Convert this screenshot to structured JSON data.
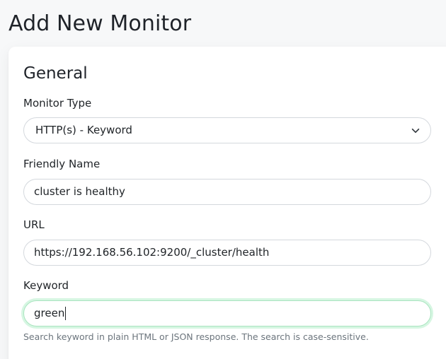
{
  "page": {
    "title": "Add New Monitor"
  },
  "general": {
    "section_title": "General",
    "monitor_type": {
      "label": "Monitor Type",
      "value": "HTTP(s) - Keyword"
    },
    "friendly_name": {
      "label": "Friendly Name",
      "value": "cluster is healthy"
    },
    "url": {
      "label": "URL",
      "value": "https://192.168.56.102:9200/_cluster/health"
    },
    "keyword": {
      "label": "Keyword",
      "value": "green",
      "help": "Search keyword in plain HTML or JSON response. The search is case-sensitive."
    }
  },
  "icons": {
    "dropdown": "chevron-down-icon"
  },
  "colors": {
    "focus_border": "#a9e4bf",
    "focus_glow": "#5cdd8b"
  }
}
